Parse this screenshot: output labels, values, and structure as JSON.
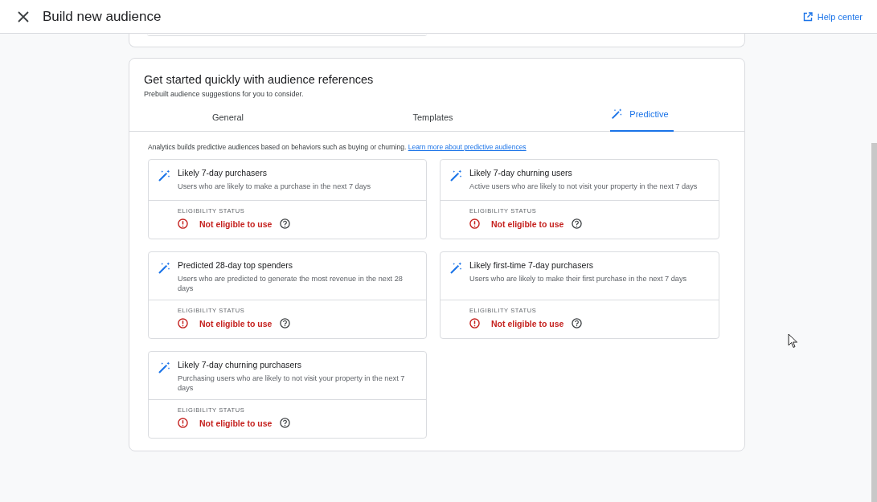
{
  "header": {
    "title": "Build new audience",
    "help_link": "Help center"
  },
  "section": {
    "title": "Get started quickly with audience references",
    "subtitle": "Prebuilt audience suggestions for you to consider."
  },
  "tabs": [
    {
      "label": "General",
      "selected": false,
      "icon": false
    },
    {
      "label": "Templates",
      "selected": false,
      "icon": false
    },
    {
      "label": "Predictive",
      "selected": true,
      "icon": true
    }
  ],
  "intro": {
    "text": "Analytics builds predictive audiences based on behaviors such as buying or churning.",
    "link": "Learn more about predictive audiences"
  },
  "audiences": [
    {
      "title": "Likely 7-day purchasers",
      "description": "Users who are likely to make a purchase in the next 7 days",
      "status_label": "ELIGIBILITY STATUS",
      "status": "Not eligible to use",
      "eligible": false
    },
    {
      "title": "Likely 7-day churning users",
      "description": "Active users who are likely to not visit your property in the next 7 days",
      "status_label": "ELIGIBILITY STATUS",
      "status": "Not eligible to use",
      "eligible": false
    },
    {
      "title": "Predicted 28-day top spenders",
      "description": "Users who are predicted to generate the most revenue in the next 28 days",
      "status_label": "ELIGIBILITY STATUS",
      "status": "Not eligible to use",
      "eligible": false
    },
    {
      "title": "Likely first-time 7-day purchasers",
      "description": "Users who are likely to make their first purchase in the next 7 days",
      "status_label": "ELIGIBILITY STATUS",
      "status": "Not eligible to use",
      "eligible": false
    },
    {
      "title": "Likely 7-day churning purchasers",
      "description": "Purchasing users who are likely to not visit your property in the next 7 days",
      "status_label": "ELIGIBILITY STATUS",
      "status": "Not eligible to use",
      "eligible": false
    }
  ]
}
